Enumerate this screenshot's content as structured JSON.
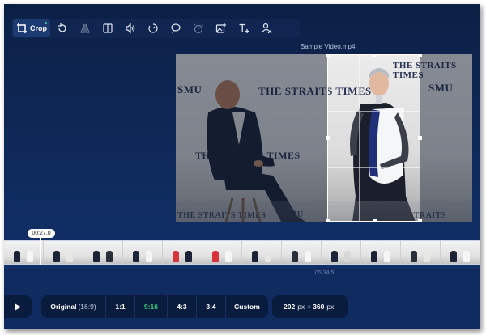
{
  "toolbar": {
    "crop_label": "Crop",
    "tools": [
      {
        "name": "crop-icon"
      },
      {
        "name": "rotate-icon"
      },
      {
        "name": "flip-icon"
      },
      {
        "name": "aspect-icon"
      },
      {
        "name": "volume-icon"
      },
      {
        "name": "speed-icon"
      },
      {
        "name": "loop-icon"
      },
      {
        "name": "timer-icon"
      },
      {
        "name": "add-image-icon"
      },
      {
        "name": "add-text-icon"
      },
      {
        "name": "remove-watermark-icon"
      }
    ]
  },
  "video": {
    "filename": "Sample Video.mp4",
    "wall_text_1": "THE STRAITS TIMES",
    "wall_text_2": "SMU"
  },
  "timeline": {
    "playhead_time": "00:27.0",
    "midpoint_time": "05:34.5",
    "frame_count": 12
  },
  "ratios": {
    "original_label": "Original",
    "original_sub": "(16:9)",
    "items": [
      "1:1",
      "9:16",
      "4:3",
      "3:4",
      "Custom"
    ],
    "active": "9:16"
  },
  "size": {
    "width": "202",
    "height": "360",
    "unit": "px",
    "separator": "×"
  },
  "colors": {
    "accent": "#34d67c",
    "bg_top": "#0c2045",
    "bg_bottom": "#123470"
  }
}
